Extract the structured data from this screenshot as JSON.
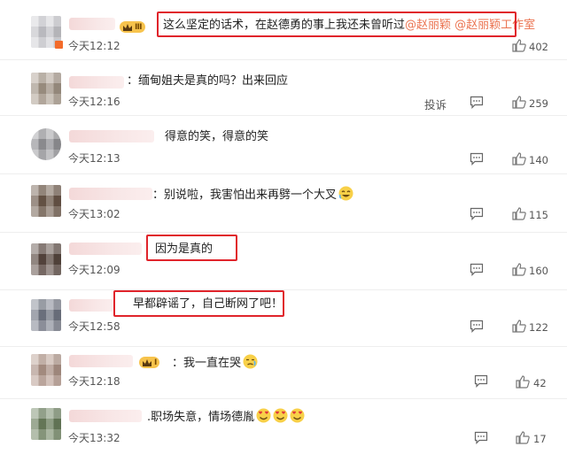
{
  "comments": [
    {
      "prefix": "",
      "text": "这么坚定的话术，在赵德勇的事上我还未曾听过",
      "mentions": [
        "@赵丽颖",
        "@赵丽颖工作室"
      ],
      "time": "今天12:12",
      "likes": "402",
      "badge": "Ⅲ",
      "report": ""
    },
    {
      "prefix": "：",
      "text": "缅甸姐夫是真的吗？出来回应",
      "mentions": [],
      "time": "今天12:16",
      "likes": "259",
      "badge": "",
      "report": "投诉"
    },
    {
      "prefix": "",
      "text": "得意的笑，得意的笑",
      "mentions": [],
      "time": "今天12:13",
      "likes": "140",
      "badge": "",
      "report": ""
    },
    {
      "prefix": "：",
      "text": "别说啦，我害怕出来再劈一个大叉",
      "mentions": [],
      "time": "今天13:02",
      "likes": "115",
      "badge": "",
      "report": ""
    },
    {
      "prefix": "",
      "text": "因为是真的",
      "mentions": [],
      "time": "今天12:09",
      "likes": "160",
      "badge": "",
      "report": ""
    },
    {
      "prefix": "",
      "text": "早都辟谣了，自己断网了吧！",
      "mentions": [],
      "time": "今天12:58",
      "likes": "122",
      "badge": "",
      "report": ""
    },
    {
      "prefix": "：",
      "text": "我一直在哭",
      "mentions": [],
      "time": "今天12:18",
      "likes": "42",
      "badge": "Ⅰ",
      "report": ""
    },
    {
      "prefix": ".",
      "text": "职场失意，情场德胤",
      "mentions": [],
      "time": "今天13:32",
      "likes": "17",
      "badge": "",
      "report": ""
    }
  ],
  "colors": {
    "highlight_box": "#e0242b",
    "mention": "#eb7350",
    "badge": "#f7c34c"
  },
  "icons": {
    "like": "thumbs-up-icon",
    "reply": "comment-reply-icon",
    "crown": "crown-icon"
  }
}
